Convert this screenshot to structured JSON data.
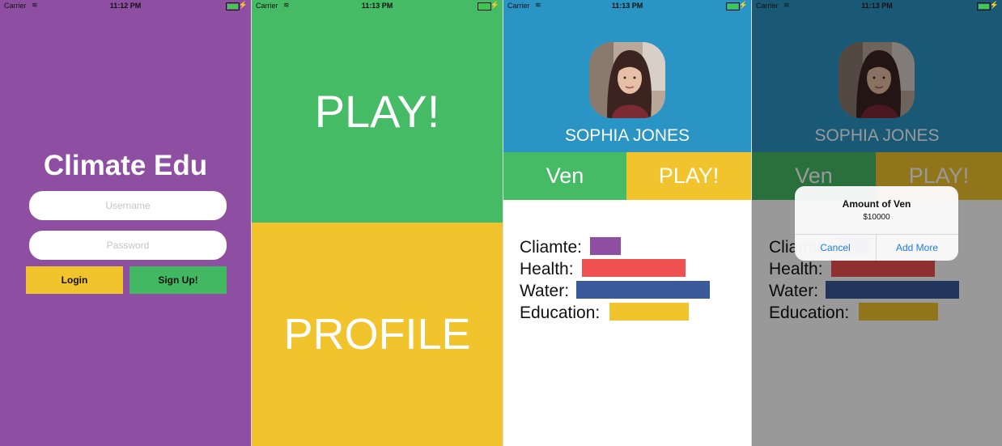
{
  "status": {
    "carrier": "Carrier",
    "wifi_icon": "≋",
    "bolt_icon": "⚡",
    "times": [
      "11:12 PM",
      "11:13 PM",
      "11:13 PM",
      "11:13 PM"
    ]
  },
  "login": {
    "title": "Climate Edu",
    "username_placeholder": "Username",
    "password_placeholder": "Password",
    "login_label": "Login",
    "signup_label": "Sign Up!"
  },
  "menu": {
    "play_label": "PLAY!",
    "profile_label": "PROFILE"
  },
  "profile": {
    "name": "SOPHIA JONES",
    "ven_label": "Ven",
    "play_label": "PLAY!",
    "stats": [
      {
        "label": "Cliamte:",
        "color": "#8e4fa3"
      },
      {
        "label": "Health:",
        "color": "#ee5150"
      },
      {
        "label": "Water:",
        "color": "#3a5a9c"
      },
      {
        "label": "Education:",
        "color": "#f1c42d"
      }
    ]
  },
  "alert": {
    "title": "Amount of Ven",
    "message": "$10000",
    "cancel_label": "Cancel",
    "add_more_label": "Add More"
  },
  "colors": {
    "purple": "#8e4fa3",
    "green": "#45bb66",
    "yellow": "#f1c42d",
    "blue": "#2a94c5",
    "red": "#ee5150",
    "navy": "#3a5a9c",
    "ios_blue": "#1f7ae6"
  }
}
